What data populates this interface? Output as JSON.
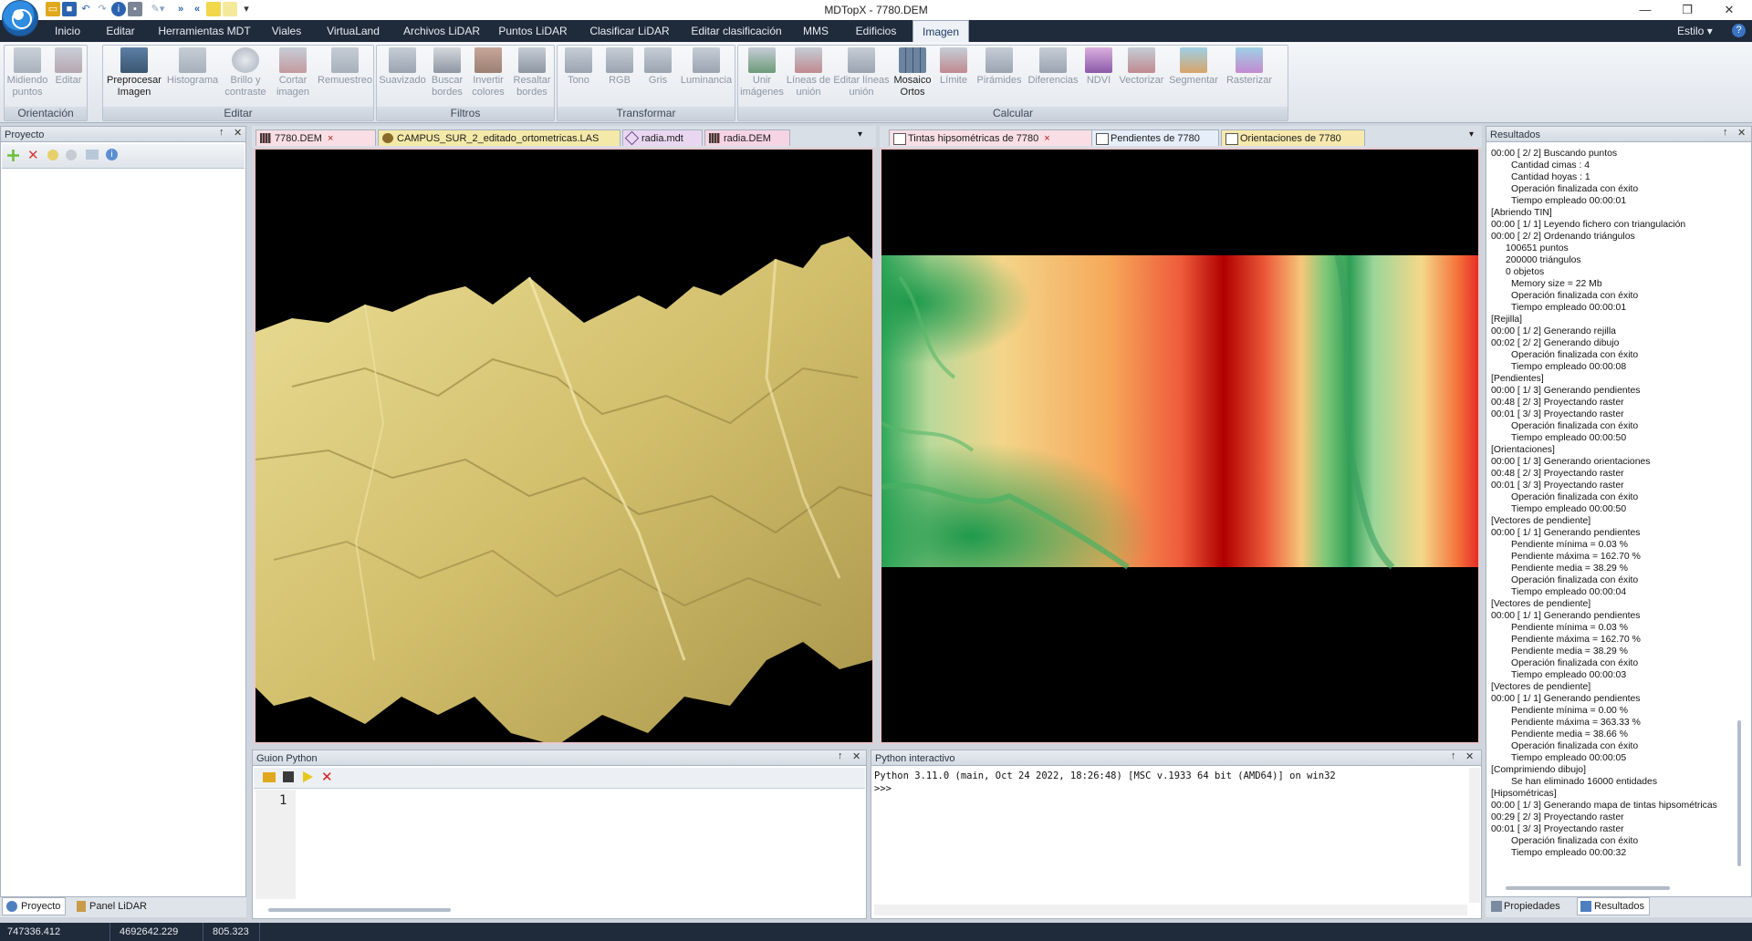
{
  "window": {
    "title": "MDTopX -  7780.DEM",
    "minimize": "—",
    "maximize": "❐",
    "close": "✕"
  },
  "quick_access": {
    "customize": "▾"
  },
  "ribbon": {
    "tabs": [
      "Inicio",
      "Editar",
      "Herramientas MDT",
      "Viales",
      "VirtuaLand",
      "Archivos LiDAR",
      "Puntos LiDAR",
      "Clasificar LiDAR",
      "Editar clasificación",
      "MMS",
      "Edificios",
      "Imagen"
    ],
    "active_tab": "Imagen",
    "style_label": "Estilo",
    "style_caret": "▾",
    "help": "?",
    "groups": [
      {
        "name": "Orientación",
        "buttons": [
          "Midiendo puntos",
          "Editar"
        ]
      },
      {
        "name": "Editar",
        "buttons": [
          "Preprocesar Imagen",
          "Histograma",
          "Brillo y contraste",
          "Cortar imagen",
          "Remuestreo"
        ]
      },
      {
        "name": "Filtros",
        "buttons": [
          "Suavizado",
          "Buscar bordes",
          "Invertir colores",
          "Resaltar bordes"
        ]
      },
      {
        "name": "Transformar",
        "buttons": [
          "Tono",
          "RGB",
          "Gris",
          "Luminancia"
        ]
      },
      {
        "name": "Calcular",
        "buttons": [
          "Unir imágenes",
          "Líneas de unión",
          "Editar líneas unión",
          "Mosaico Ortos",
          "Límite",
          "Pirámides",
          "Diferencias",
          "NDVI",
          "Vectorizar",
          "Segmentar",
          "Rasterizar"
        ]
      }
    ]
  },
  "panels": {
    "project": {
      "title": "Proyecto",
      "pin": "↑",
      "close": "✕",
      "bottom_tabs": [
        "Proyecto",
        "Panel LiDAR"
      ]
    },
    "documents_left": {
      "tabs": [
        "7780.DEM",
        "CAMPUS_SUR_2_editado_ortometricas.LAS",
        "radia.mdt",
        "radia.DEM"
      ],
      "tab_close": "×",
      "menu": "▾"
    },
    "documents_right": {
      "tabs": [
        "Tintas hipsométricas de 7780",
        "Pendientes de 7780",
        "Orientaciones de 7780"
      ],
      "tab_close": "×",
      "menu": "▾"
    },
    "python_script": {
      "title": "Guion Python",
      "line_number": "1"
    },
    "python_interactive": {
      "title": "Python interactivo",
      "banner": "Python 3.11.0 (main, Oct 24 2022, 18:26:48) [MSC v.1933 64 bit (AMD64)] on win32",
      "prompt": ">>>"
    },
    "results": {
      "title": "Resultados",
      "bottom_tabs": [
        "Propiedades",
        "Resultados"
      ]
    }
  },
  "results_log": [
    {
      "t": "00:00 [ 2/ 2] Buscando puntos",
      "lvl": 0
    },
    {
      "t": "Cantidad cimas : 4",
      "lvl": 2
    },
    {
      "t": "Cantidad hoyas : 1",
      "lvl": 2
    },
    {
      "t": "Operación finalizada con éxito",
      "lvl": 2
    },
    {
      "t": "Tiempo empleado 00:00:01",
      "lvl": 2
    },
    {
      "t": "[Abriendo TIN]",
      "lvl": 0
    },
    {
      "t": "00:00 [ 1/ 1] Leyendo fichero con triangulación",
      "lvl": 0
    },
    {
      "t": "00:00 [ 2/ 2] Ordenando triángulos",
      "lvl": 0
    },
    {
      "t": "100651 puntos",
      "lvl": 1
    },
    {
      "t": "200000 triángulos",
      "lvl": 1
    },
    {
      "t": "0 objetos",
      "lvl": 1
    },
    {
      "t": "Memory size = 22 Mb",
      "lvl": 2
    },
    {
      "t": "Operación finalizada con éxito",
      "lvl": 2
    },
    {
      "t": "Tiempo empleado 00:00:01",
      "lvl": 2
    },
    {
      "t": "[Rejilla]",
      "lvl": 0
    },
    {
      "t": "00:00 [ 1/ 2] Generando rejilla",
      "lvl": 0
    },
    {
      "t": "00:02 [ 2/ 2] Generando dibujo",
      "lvl": 0
    },
    {
      "t": "Operación finalizada con éxito",
      "lvl": 2
    },
    {
      "t": "Tiempo empleado 00:00:08",
      "lvl": 2
    },
    {
      "t": "[Pendientes]",
      "lvl": 0
    },
    {
      "t": "00:00 [ 1/ 3] Generando pendientes",
      "lvl": 0
    },
    {
      "t": "00:48 [ 2/ 3] Proyectando raster",
      "lvl": 0
    },
    {
      "t": "00:01 [ 3/ 3] Proyectando raster",
      "lvl": 0
    },
    {
      "t": "Operación finalizada con éxito",
      "lvl": 2
    },
    {
      "t": "Tiempo empleado 00:00:50",
      "lvl": 2
    },
    {
      "t": "[Orientaciones]",
      "lvl": 0
    },
    {
      "t": "00:00 [ 1/ 3] Generando orientaciones",
      "lvl": 0
    },
    {
      "t": "00:48 [ 2/ 3] Proyectando raster",
      "lvl": 0
    },
    {
      "t": "00:01 [ 3/ 3] Proyectando raster",
      "lvl": 0
    },
    {
      "t": "Operación finalizada con éxito",
      "lvl": 2
    },
    {
      "t": "Tiempo empleado 00:00:50",
      "lvl": 2
    },
    {
      "t": "[Vectores de pendiente]",
      "lvl": 0
    },
    {
      "t": "00:00 [ 1/ 1] Generando pendientes",
      "lvl": 0
    },
    {
      "t": "Pendiente mínima = 0.03 %",
      "lvl": 2
    },
    {
      "t": "Pendiente máxima = 162.70 %",
      "lvl": 2
    },
    {
      "t": "Pendiente media = 38.29 %",
      "lvl": 2
    },
    {
      "t": "Operación finalizada con éxito",
      "lvl": 2
    },
    {
      "t": "Tiempo empleado 00:00:04",
      "lvl": 2
    },
    {
      "t": "[Vectores de pendiente]",
      "lvl": 0
    },
    {
      "t": "00:00 [ 1/ 1] Generando pendientes",
      "lvl": 0
    },
    {
      "t": "Pendiente mínima = 0.03 %",
      "lvl": 2
    },
    {
      "t": "Pendiente máxima = 162.70 %",
      "lvl": 2
    },
    {
      "t": "Pendiente media = 38.29 %",
      "lvl": 2
    },
    {
      "t": "Operación finalizada con éxito",
      "lvl": 2
    },
    {
      "t": "Tiempo empleado 00:00:03",
      "lvl": 2
    },
    {
      "t": "[Vectores de pendiente]",
      "lvl": 0
    },
    {
      "t": "00:00 [ 1/ 1] Generando pendientes",
      "lvl": 0
    },
    {
      "t": "Pendiente mínima = 0.00 %",
      "lvl": 2
    },
    {
      "t": "Pendiente máxima = 363.33 %",
      "lvl": 2
    },
    {
      "t": "Pendiente media = 38.66 %",
      "lvl": 2
    },
    {
      "t": "Operación finalizada con éxito",
      "lvl": 2
    },
    {
      "t": "Tiempo empleado 00:00:05",
      "lvl": 2
    },
    {
      "t": "[Comprimiendo dibujo]",
      "lvl": 0
    },
    {
      "t": "Se han eliminado 16000 entidades",
      "lvl": 2
    },
    {
      "t": "[Hipsométricas]",
      "lvl": 0
    },
    {
      "t": "00:00 [ 1/ 3] Generando mapa de tintas hipsométricas",
      "lvl": 0
    },
    {
      "t": "00:29 [ 2/ 3] Proyectando raster",
      "lvl": 0
    },
    {
      "t": "00:01 [ 3/ 3] Proyectando raster",
      "lvl": 0
    },
    {
      "t": "Operación finalizada con éxito",
      "lvl": 2
    },
    {
      "t": "Tiempo empleado 00:00:32",
      "lvl": 2
    }
  ],
  "statusbar": {
    "x": "747336.412",
    "y": "4692642.229",
    "z": "805.323"
  },
  "colors": {
    "accent": "#1f2a3a",
    "terrain": "#d8c878",
    "hypso_low": "#1e9a4a",
    "hypso_high": "#c80000"
  }
}
